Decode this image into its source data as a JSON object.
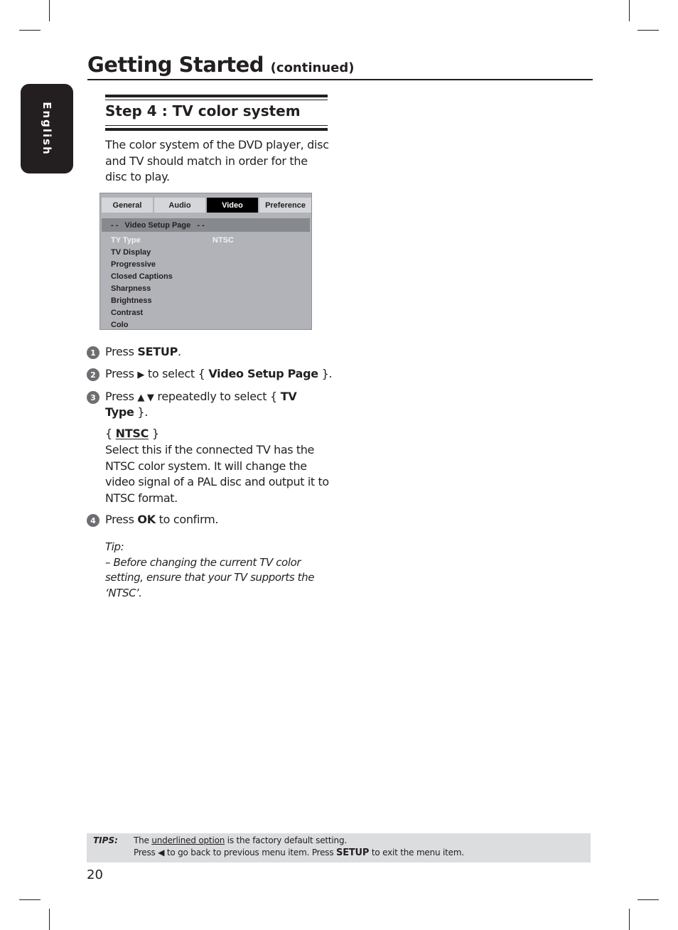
{
  "sidebar": {
    "language_tab": "English"
  },
  "header": {
    "title": "Getting Started",
    "title_suffix": "(continued)"
  },
  "section": {
    "title": "Step 4 : TV color system",
    "intro": "The color system of the DVD player, disc and TV should match in order for the disc to play."
  },
  "osd_menu": {
    "tabs": [
      {
        "label": "General",
        "active": false
      },
      {
        "label": "Audio",
        "active": false
      },
      {
        "label": "Video",
        "active": true
      },
      {
        "label": "Preference",
        "active": false
      }
    ],
    "header": "- -   Video Setup Page   - -",
    "items": [
      {
        "label": "TY Type",
        "selected": true
      },
      {
        "label": "TV Display"
      },
      {
        "label": "Progressive"
      },
      {
        "label": "Closed Captions"
      },
      {
        "label": "Sharpness"
      },
      {
        "label": "Brightness"
      },
      {
        "label": "Contrast"
      },
      {
        "label": "Colo"
      }
    ],
    "selected_value": "NTSC"
  },
  "steps": [
    {
      "number": "1",
      "pre": "Press ",
      "bold": "SETUP",
      "post": "."
    },
    {
      "number": "2",
      "pre": "Press ",
      "icon": "▶",
      "mid": " to select { ",
      "bold": "Video Setup Page",
      "post": " }."
    },
    {
      "number": "3",
      "pre": "Press ",
      "icon": "▲ ▼",
      "mid": " repeatedly to select { ",
      "bold": "TV",
      "bold2": "Type",
      "post": " }."
    },
    {
      "number": "4",
      "pre": "Press ",
      "bold": "OK",
      "post": " to confirm."
    }
  ],
  "option": {
    "brace_open": "{ ",
    "name": "NTSC",
    "brace_close": " }",
    "description": "Select this if the connected TV has the NTSC color system. It will change the video signal of a PAL disc and output it to NTSC format."
  },
  "tip": {
    "label": "Tip:",
    "text": "– Before changing the current TV color setting, ensure that your TV supports the ‘NTSC’."
  },
  "footer_tips": {
    "label": "TIPS:",
    "line1_pre": "The ",
    "line1_underlined": "underlined option",
    "line1_post": " is the factory default setting.",
    "line2_pre": "Press ",
    "line2_icon": "◀",
    "line2_mid": " to go back to previous menu item. Press ",
    "line2_bold": "SETUP",
    "line2_post": " to exit the menu item."
  },
  "page_number": "20"
}
